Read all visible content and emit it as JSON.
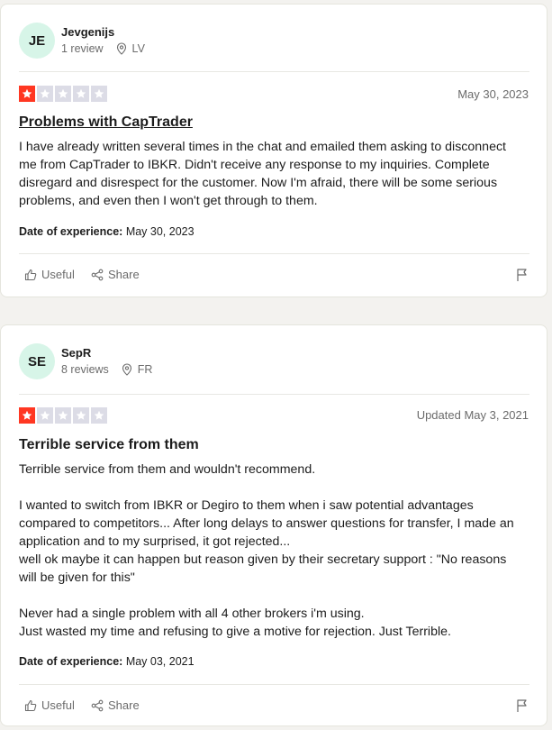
{
  "reviews": [
    {
      "avatar_initials": "JE",
      "username": "Jevgenijs",
      "review_count": "1 review",
      "country": "LV",
      "rating": 1,
      "date": "May 30, 2023",
      "title": "Problems with CapTrader",
      "body": "I have already written several times in the chat and emailed them asking to disconnect me from CapTrader to IBKR. Didn't receive any response to my inquiries. Complete disregard and disrespect for the customer. Now I'm afraid, there will be some serious problems, and even then I won't get through to them.",
      "experience_label": "Date of experience:",
      "experience_date": "May 30, 2023",
      "useful_label": "Useful",
      "share_label": "Share"
    },
    {
      "avatar_initials": "SE",
      "username": "SepR",
      "review_count": "8 reviews",
      "country": "FR",
      "rating": 1,
      "date": "Updated May 3, 2021",
      "title": "Terrible service from them",
      "body": "Terrible service from them and wouldn't recommend.\n\nI wanted to switch from IBKR or Degiro to them when i saw potential advantages compared to competitors... After long delays to answer questions for transfer, I made an application and to my surprised, it got rejected...\nwell ok maybe it can happen but reason given by their secretary support : \"No reasons will be given for this\"\n\nNever had a single problem with all 4 other brokers i'm using.\nJust wasted my time and refusing to give a motive for rejection. Just Terrible.",
      "experience_label": "Date of experience:",
      "experience_date": "May 03, 2021",
      "useful_label": "Useful",
      "share_label": "Share"
    }
  ],
  "colors": {
    "star_active": "#ff3722",
    "star_inactive": "#dcdce6",
    "avatar_bg": "#d7f5e8"
  },
  "icons": [
    "location-pin-icon",
    "thumbs-up-icon",
    "share-icon",
    "flag-icon",
    "star-icon"
  ]
}
